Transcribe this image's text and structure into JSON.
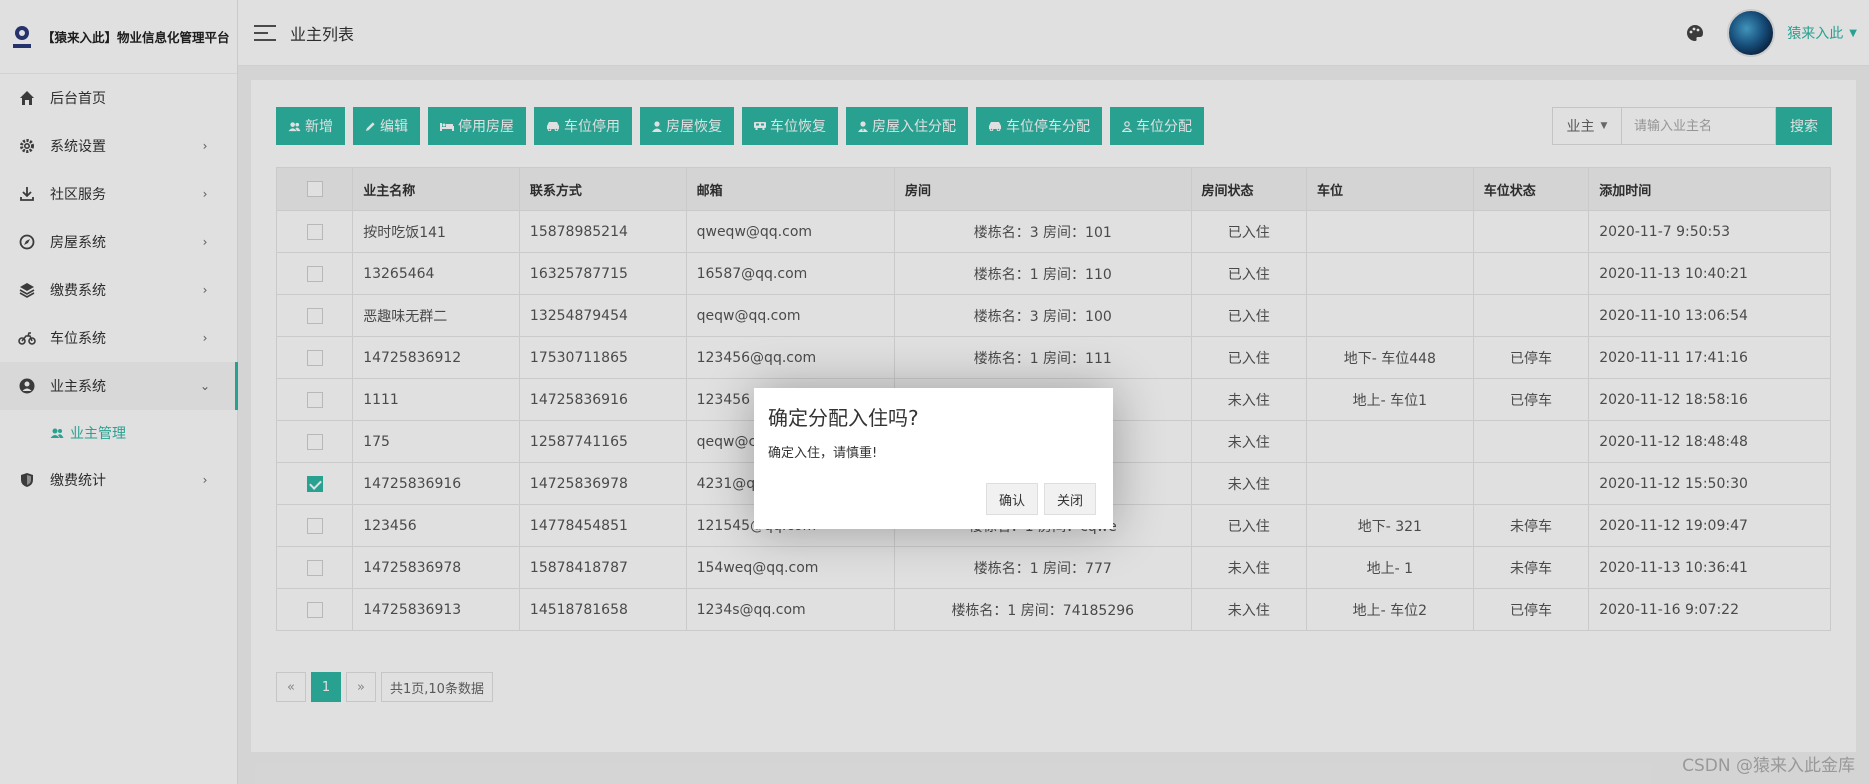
{
  "app": {
    "logo_caption": "猿来入此",
    "title": "【猿来入此】物业信息化管理平台"
  },
  "sidebar": {
    "items": [
      {
        "label": "后台首页",
        "icon": "home-icon",
        "has_children": false
      },
      {
        "label": "系统设置",
        "icon": "gear-icon",
        "has_children": true
      },
      {
        "label": "社区服务",
        "icon": "download-icon",
        "has_children": true
      },
      {
        "label": "房屋系统",
        "icon": "compass-icon",
        "has_children": true
      },
      {
        "label": "缴费系统",
        "icon": "layers-icon",
        "has_children": true
      },
      {
        "label": "车位系统",
        "icon": "motorcycle-icon",
        "has_children": true
      },
      {
        "label": "业主系统",
        "icon": "user-circle-icon",
        "has_children": true,
        "expanded": true
      },
      {
        "label": "缴费统计",
        "icon": "shield-icon",
        "has_children": true
      }
    ],
    "sub_items": [
      {
        "label": "业主管理",
        "icon": "users-icon"
      }
    ]
  },
  "header": {
    "title": "业主列表",
    "user_name": "猿来入此"
  },
  "toolbar": {
    "buttons": [
      {
        "label": "新增",
        "icon": "users-icon"
      },
      {
        "label": "编辑",
        "icon": "pencil-icon"
      },
      {
        "label": "停用房屋",
        "icon": "bed-icon"
      },
      {
        "label": "车位停用",
        "icon": "car-icon"
      },
      {
        "label": "房屋恢复",
        "icon": "user-icon"
      },
      {
        "label": "车位恢复",
        "icon": "bus-icon"
      },
      {
        "label": "房屋入住分配",
        "icon": "user-tie-icon"
      },
      {
        "label": "车位停车分配",
        "icon": "car-icon"
      },
      {
        "label": "车位分配",
        "icon": "user-outline-icon"
      }
    ]
  },
  "search": {
    "select_value": "业主",
    "placeholder": "请输入业主名",
    "button_label": "搜索"
  },
  "table": {
    "columns": [
      "业主名称",
      "联系方式",
      "邮箱",
      "房间",
      "房间状态",
      "车位",
      "车位状态",
      "添加时间"
    ],
    "rows": [
      {
        "checked": false,
        "name": "按时吃饭141",
        "phone": "15878985214",
        "email": "qweqw@qq.com",
        "room": "楼栋名：3 房间：101",
        "room_status": "已入住",
        "room_status_ok": true,
        "parking": "",
        "parking_status": "",
        "parking_status_ok": true,
        "time": "2020-11-7 9:50:53"
      },
      {
        "checked": false,
        "name": "13265464",
        "phone": "16325787715",
        "email": "16587@qq.com",
        "room": "楼栋名：1 房间：110",
        "room_status": "已入住",
        "room_status_ok": true,
        "parking": "",
        "parking_status": "",
        "parking_status_ok": true,
        "time": "2020-11-13 10:40:21"
      },
      {
        "checked": false,
        "name": "恶趣味无群二",
        "phone": "13254879454",
        "email": "qeqw@qq.com",
        "room": "楼栋名：3 房间：100",
        "room_status": "已入住",
        "room_status_ok": true,
        "parking": "",
        "parking_status": "",
        "parking_status_ok": true,
        "time": "2020-11-10 13:06:54"
      },
      {
        "checked": false,
        "name": "14725836912",
        "phone": "17530711865",
        "email": "123456@qq.com",
        "room": "楼栋名：1 房间：111",
        "room_status": "已入住",
        "room_status_ok": true,
        "parking": "地下- 车位448",
        "parking_status": "已停车",
        "parking_status_ok": true,
        "time": "2020-11-11 17:41:16"
      },
      {
        "checked": false,
        "name": "1111",
        "phone": "14725836916",
        "email": "123456",
        "room": "",
        "room_status": "未入住",
        "room_status_ok": false,
        "parking": "地上- 车位1",
        "parking_status": "已停车",
        "parking_status_ok": true,
        "time": "2020-11-12 18:58:16"
      },
      {
        "checked": false,
        "name": "175",
        "phone": "12587741165",
        "email": "qeqw@c",
        "room": "",
        "room_status": "未入住",
        "room_status_ok": false,
        "parking": "",
        "parking_status": "",
        "parking_status_ok": true,
        "time": "2020-11-12 18:48:48"
      },
      {
        "checked": true,
        "name": "14725836916",
        "phone": "14725836978",
        "email": "4231@q",
        "room": "",
        "room_status": "未入住",
        "room_status_ok": false,
        "parking": "",
        "parking_status": "",
        "parking_status_ok": true,
        "time": "2020-11-12 15:50:30"
      },
      {
        "checked": false,
        "name": "123456",
        "phone": "14778454851",
        "email": "121545@qq.com",
        "room": "楼栋名：1 房间：cqwe",
        "room_status": "已入住",
        "room_status_ok": true,
        "parking": "地下- 321",
        "parking_status": "未停车",
        "parking_status_ok": false,
        "time": "2020-11-12 19:09:47"
      },
      {
        "checked": false,
        "name": "14725836978",
        "phone": "15878418787",
        "email": "154weq@qq.com",
        "room": "楼栋名：1 房间：777",
        "room_status": "未入住",
        "room_status_ok": false,
        "parking": "地上- 1",
        "parking_status": "未停车",
        "parking_status_ok": false,
        "time": "2020-11-13 10:36:41"
      },
      {
        "checked": false,
        "name": "14725836913",
        "phone": "14518781658",
        "email": "1234s@qq.com",
        "room": "楼栋名：1 房间：74185296",
        "room_status": "未入住",
        "room_status_ok": false,
        "parking": "地上- 车位2",
        "parking_status": "已停车",
        "parking_status_ok": true,
        "time": "2020-11-16 9:07:22"
      }
    ]
  },
  "pagination": {
    "prev": "«",
    "current": "1",
    "next": "»",
    "info": "共1页,10条数据"
  },
  "modal": {
    "title": "确定分配入住吗?",
    "message": "确定入住，请慎重!",
    "confirm_label": "确认",
    "close_label": "关闭"
  },
  "watermark": "CSDN @猿来入此金库",
  "colors": {
    "accent": "#2fb8a5",
    "warning": "#f0932b"
  }
}
